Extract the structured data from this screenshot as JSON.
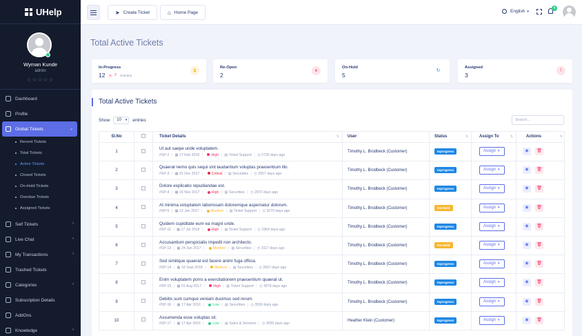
{
  "sidebar": {
    "brand": "UHelp",
    "profile": {
      "name": "Wyman Kunde",
      "role": "admin",
      "stars": "☆☆☆☆☆"
    },
    "nav": [
      {
        "label": "Dashboard",
        "chev": ""
      },
      {
        "label": "Profile",
        "chev": ""
      },
      {
        "label": "Global Tickets",
        "chev": "⌄",
        "active": true
      },
      {
        "label": "Self Tickets",
        "chev": "›"
      },
      {
        "label": "Live Chat",
        "chev": "›"
      },
      {
        "label": "My Transactions",
        "chev": "›"
      },
      {
        "label": "Trashed Tickets",
        "chev": ""
      },
      {
        "label": "Categories",
        "chev": "›"
      },
      {
        "label": "Subscription Details",
        "chev": ""
      },
      {
        "label": "AddOns",
        "chev": ""
      },
      {
        "label": "Knowledge",
        "chev": "›"
      }
    ],
    "sub": [
      "Recent Tickets",
      "Total Tickets",
      "Active Tickets",
      "Closed Tickets",
      "On-Hold Tickets",
      "Overdue Tickets",
      "Assigned Tickets"
    ]
  },
  "header": {
    "create": "Create Ticket",
    "home": "Home Page",
    "language": "English",
    "notif_count": "4"
  },
  "page_title": "Total Active Tickets",
  "cards": [
    {
      "label": "In-Progress",
      "value": "12",
      "overdue_count": "2",
      "overdue_label": "Overdue",
      "icon": "hourglass-icon",
      "icon_glyph": "⧗",
      "color": "#f7b731",
      "bg": "#fef3de"
    },
    {
      "label": "Re-Open",
      "value": "2",
      "icon": "pause-icon",
      "icon_glyph": "⏸",
      "color": "#f7346b",
      "bg": "#fde4e8"
    },
    {
      "label": "On-Hold",
      "value": "5",
      "icon": "refresh-icon",
      "icon_glyph": "↻",
      "color": "#1e88e5",
      "bg": "#ffffff"
    },
    {
      "label": "Assigned",
      "value": "3",
      "icon": "alert-icon",
      "icon_glyph": "!",
      "color": "#f7346b",
      "bg": "#fde4e8"
    }
  ],
  "table": {
    "title": "Total Active Tickets",
    "show_label": "Show",
    "entries_value": "10",
    "entries_label": "entries",
    "search_placeholder": "Search...",
    "headers": [
      "Sl.No",
      "",
      "Ticket Details",
      "User",
      "Status",
      "Assign To",
      "Actions"
    ],
    "assign_label": "Assign",
    "rows": [
      {
        "no": "1",
        "title": "Ut aut saepe unde voluptatem.",
        "id": "#SP-2",
        "date": "17 Feb 2018",
        "priority": "High",
        "category": "Ticket Support",
        "ago": "2730 days ago",
        "user": "Timothy L. Brodbeck (Customer)",
        "status": "Inprogress"
      },
      {
        "no": "2",
        "title": "Quaerat nemo quis sequi sint laudantium voluptas praesentium illo.",
        "id": "#SP-3",
        "date": "01 Dec 2017",
        "priority": "Critical",
        "category": "Securities",
        "ago": "2957 days ago",
        "user": "Timothy L. Brodbeck (Customer)",
        "status": "Inprogress"
      },
      {
        "no": "3",
        "title": "Dolore explicabo repudiandae est.",
        "id": "#SP-4",
        "date": "16 Nov 2017",
        "priority": "High",
        "category": "Securities",
        "ago": "2972 days ago",
        "user": "Timothy L. Brodbeck (Customer)",
        "status": "Inprogress"
      },
      {
        "no": "4",
        "title": "At minima voluptatem laboriosam doloremque aspernatur dolorum.",
        "id": "#SP-5",
        "date": "13 Jan 2017",
        "priority": "Medium",
        "category": "Ticket Support",
        "ago": "3279 days ago",
        "user": "Timothy L. Brodbeck (Customer)",
        "status": "On-Hold"
      },
      {
        "no": "5",
        "title": "Quidem cupiditate eum ea magni unde.",
        "id": "#SP-11",
        "date": "17 Jul 2019",
        "priority": "High",
        "category": "Ticket Support",
        "ago": "2364 days ago",
        "user": "Timothy L. Brodbeck (Customer)",
        "status": "Inprogress"
      },
      {
        "no": "6",
        "title": "Accusantium perspiciatis impedit non architecto.",
        "id": "#SP-13",
        "date": "24 Jan 2017",
        "priority": "Medium",
        "category": "Securities",
        "ago": "3117 days ago",
        "user": "Timothy L. Brodbeck (Customer)",
        "status": "On-Hold"
      },
      {
        "no": "7",
        "title": "Sed similique quaerat est facere animi fuga officia.",
        "id": "#SP-14",
        "date": "16 Sept 2018",
        "priority": "Medium",
        "category": "Securities",
        "ago": "2667 days ago",
        "user": "Timothy L. Brodbeck (Customer)",
        "status": "Inprogress"
      },
      {
        "no": "8",
        "title": "Enim voluptatem porro a exercitationem praesentium quaerat ut.",
        "id": "#SP-15",
        "date": "01 Aug 2017",
        "priority": "High",
        "category": "Ticket Support",
        "ago": "3079 days ago",
        "user": "Timothy L. Brodbeck (Customer)",
        "status": "Inprogress"
      },
      {
        "no": "9",
        "title": "Debitis sunt cumque veniam ducimus sed rerum.",
        "id": "#SP-16",
        "date": "17 Apr 2016",
        "priority": "Low",
        "category": "Securities",
        "ago": "3550 days ago",
        "user": "Timothy L. Brodbeck (Customer)",
        "status": "Inprogress"
      },
      {
        "no": "10",
        "title": "Assumenda esse voluptas sit.",
        "id": "#SP-17",
        "date": "17 Apr 2016",
        "priority": "Low",
        "category": "Sales & Services",
        "ago": "3550 days ago",
        "user": "Heather Klein (Customer)",
        "status": "Inprogress"
      }
    ]
  },
  "colors": {
    "priority": {
      "High": "#f7346b",
      "Critical": "#e82646",
      "Medium": "#f7b731",
      "Low": "#2dce89"
    },
    "status": {
      "Inprogress": "#1e88e5",
      "On-Hold": "#f7b731"
    },
    "accent": "#5c6de6"
  }
}
